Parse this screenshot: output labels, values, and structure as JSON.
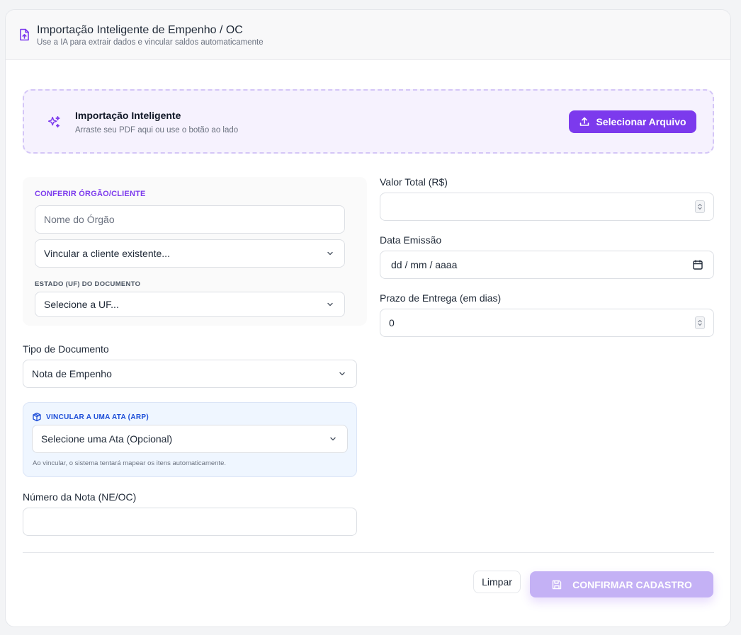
{
  "header": {
    "title": "Importação Inteligente de Empenho / OC",
    "subtitle": "Use a IA para extrair dados e vincular saldos automaticamente"
  },
  "dropzone": {
    "title": "Importação Inteligente",
    "subtitle": "Arraste seu PDF aqui ou use o botão ao lado",
    "button_label": "Selecionar Arquivo"
  },
  "orgao": {
    "section_label": "CONFERIR ÓRGÃO/CLIENTE",
    "name_placeholder": "Nome do Órgão",
    "client_select": "Vincular a cliente existente...",
    "uf_label": "ESTADO (UF) DO DOCUMENTO",
    "uf_select": "Selecione a UF..."
  },
  "tipo_documento": {
    "label": "Tipo de Documento",
    "value": "Nota de Empenho"
  },
  "ata": {
    "label": "VINCULAR A UMA ATA (ARP)",
    "select": "Selecione uma Ata (Opcional)",
    "hint": "Ao vincular, o sistema tentará mapear os itens automaticamente."
  },
  "numero_nota": {
    "label": "Número da Nota (NE/OC)",
    "value": ""
  },
  "valor_total": {
    "label": "Valor Total (R$)",
    "value": ""
  },
  "data_emissao": {
    "label": "Data Emissão",
    "placeholder": "dd / mm / aaaa"
  },
  "prazo_entrega": {
    "label": "Prazo de Entrega (em dias)",
    "value": "0"
  },
  "actions": {
    "clear_label": "Limpar",
    "confirm_label": "CONFIRMAR CADASTRO"
  },
  "colors": {
    "accent": "#7c3aed",
    "accent_disabled": "#c4b1f5",
    "ata_blue": "#1d4ed8"
  }
}
